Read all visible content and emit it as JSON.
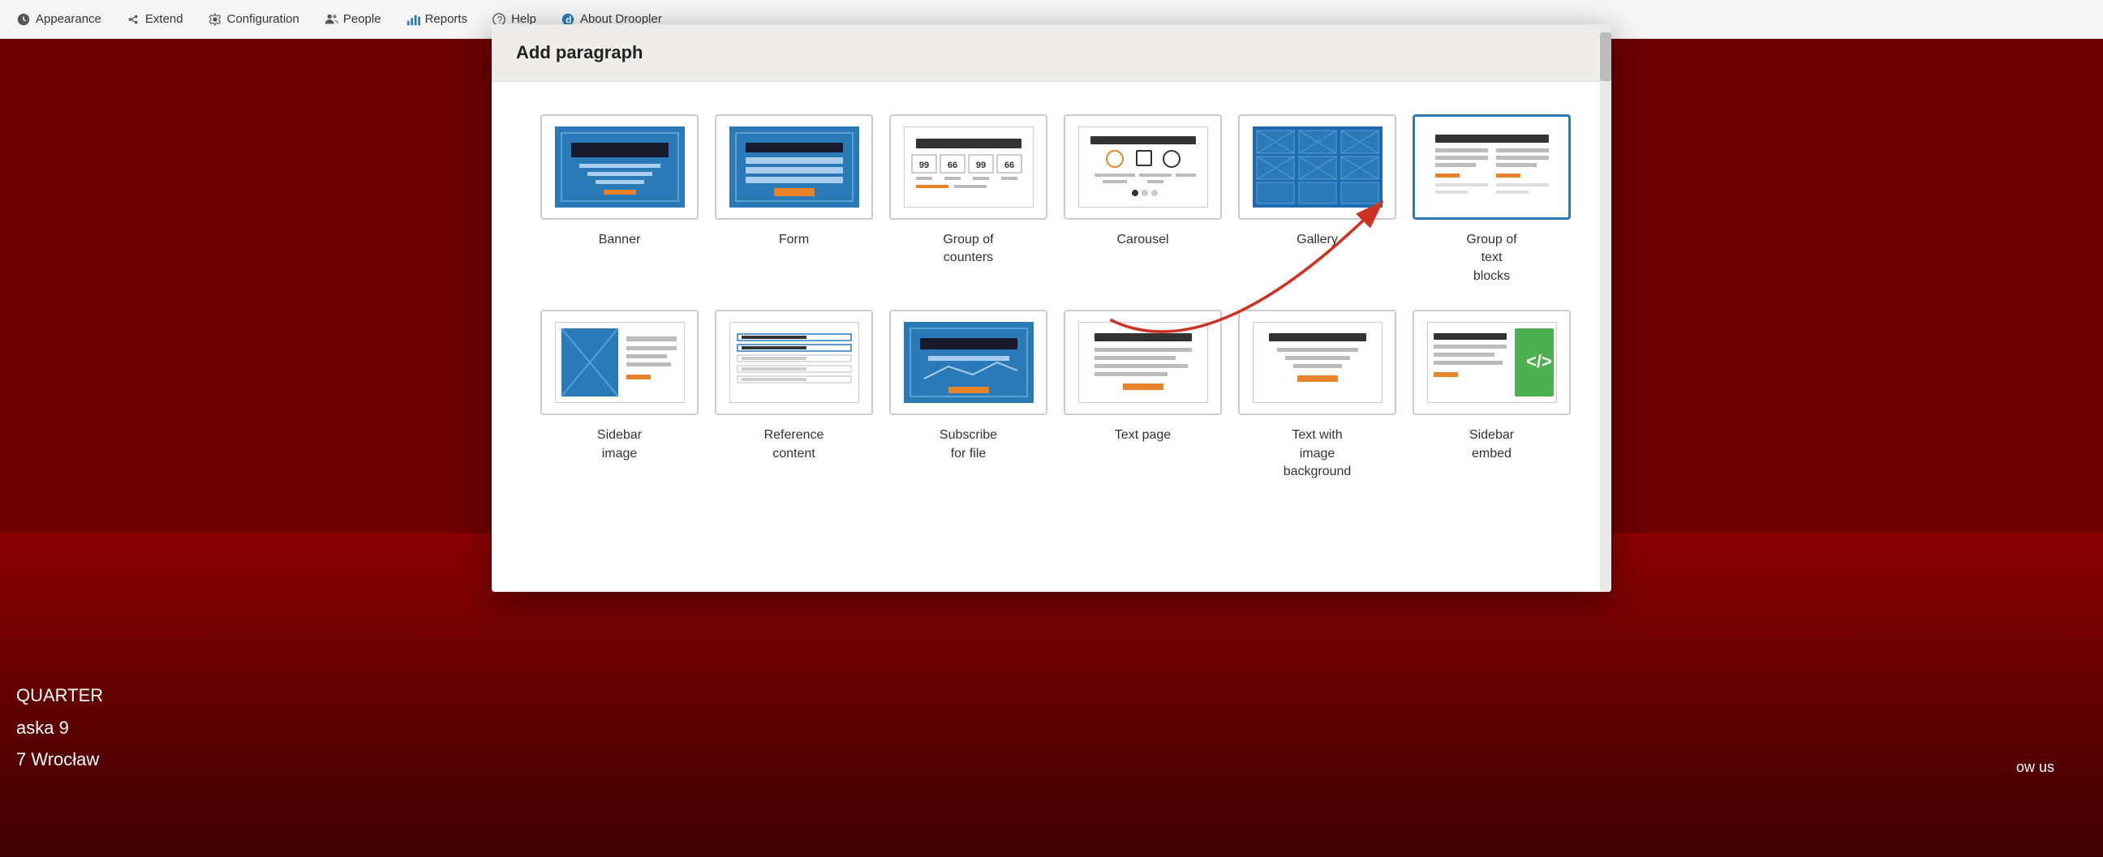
{
  "nav": {
    "items": [
      {
        "label": "Appearance",
        "icon": "appearance-icon"
      },
      {
        "label": "Extend",
        "icon": "extend-icon"
      },
      {
        "label": "Configuration",
        "icon": "configuration-icon"
      },
      {
        "label": "People",
        "icon": "people-icon"
      },
      {
        "label": "Reports",
        "icon": "reports-icon"
      },
      {
        "label": "Help",
        "icon": "help-icon"
      },
      {
        "label": "About Droopler",
        "icon": "about-icon"
      }
    ]
  },
  "modal": {
    "title": "Add paragraph",
    "paragraph_types": [
      {
        "id": "banner",
        "label": "Banner",
        "selected": false
      },
      {
        "id": "form",
        "label": "Form",
        "selected": false
      },
      {
        "id": "group-of-counters",
        "label": "Group of\ncounters",
        "selected": false
      },
      {
        "id": "carousel",
        "label": "Carousel",
        "selected": false
      },
      {
        "id": "gallery",
        "label": "Gallery",
        "selected": false
      },
      {
        "id": "group-of-text-blocks",
        "label": "Group of\ntext\nblocks",
        "selected": true
      },
      {
        "id": "sidebar-image",
        "label": "Sidebar\nimage",
        "selected": false
      },
      {
        "id": "reference-content",
        "label": "Reference\ncontent",
        "selected": false
      },
      {
        "id": "subscribe-for-file",
        "label": "Subscribe\nfor file",
        "selected": false
      },
      {
        "id": "text-page",
        "label": "Text page",
        "selected": false
      },
      {
        "id": "text-with-image-background",
        "label": "Text with\nimage\nbackground",
        "selected": false
      },
      {
        "id": "sidebar-embed",
        "label": "Sidebar\nembed",
        "selected": false
      }
    ]
  },
  "background": {
    "address_lines": [
      "QUARTER",
      "aska 9",
      "7 Wrocław"
    ],
    "right_text": "ow us"
  }
}
